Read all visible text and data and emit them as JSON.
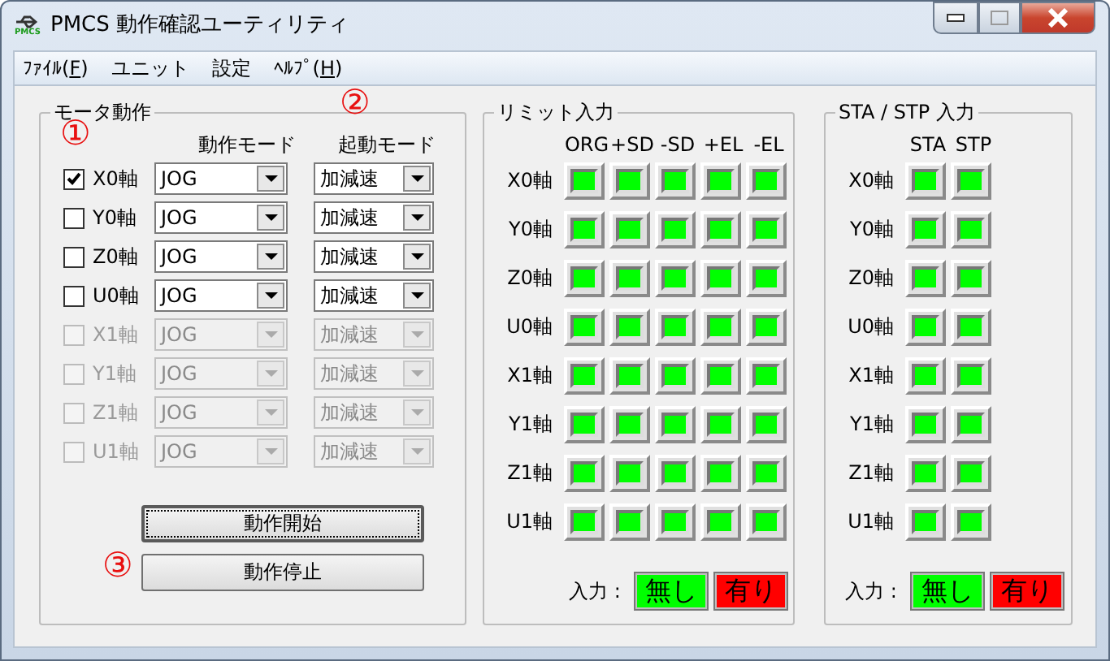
{
  "window": {
    "title": "PMCS 動作確認ユーティリティ",
    "icon_text": "PMCS"
  },
  "menu": [
    {
      "before": "ﾌｧｲﾙ(",
      "access_key": "F",
      "after": ")"
    },
    {
      "before": "ユニット"
    },
    {
      "before": "設定"
    },
    {
      "before": "ﾍﾙﾌﾟ(",
      "access_key": "H",
      "after": ")"
    }
  ],
  "motor": {
    "title": "モータ動作",
    "columns": [
      "動作モード",
      "起動モード"
    ],
    "axes": [
      {
        "label": "X0軸",
        "checked": true,
        "disabled": false,
        "mode": "JOG",
        "start_mode": "加減速"
      },
      {
        "label": "Y0軸",
        "checked": false,
        "disabled": false,
        "mode": "JOG",
        "start_mode": "加減速"
      },
      {
        "label": "Z0軸",
        "checked": false,
        "disabled": false,
        "mode": "JOG",
        "start_mode": "加減速"
      },
      {
        "label": "U0軸",
        "checked": false,
        "disabled": false,
        "mode": "JOG",
        "start_mode": "加減速"
      },
      {
        "label": "X1軸",
        "checked": false,
        "disabled": true,
        "mode": "JOG",
        "start_mode": "加減速"
      },
      {
        "label": "Y1軸",
        "checked": false,
        "disabled": true,
        "mode": "JOG",
        "start_mode": "加減速"
      },
      {
        "label": "Z1軸",
        "checked": false,
        "disabled": true,
        "mode": "JOG",
        "start_mode": "加減速"
      },
      {
        "label": "U1軸",
        "checked": false,
        "disabled": true,
        "mode": "JOG",
        "start_mode": "加減速"
      }
    ],
    "buttons": [
      {
        "label": "動作開始",
        "focused": true
      },
      {
        "label": "動作停止",
        "focused": false
      }
    ]
  },
  "annotations": [
    "①",
    "②",
    "③"
  ],
  "limit": {
    "title": "リミット入力",
    "columns": [
      "ORG",
      "+SD",
      "-SD",
      "+EL",
      "-EL"
    ],
    "rows": [
      {
        "label": "X0軸",
        "inputs": [
          {
            "on": false
          },
          {
            "on": false
          },
          {
            "on": false
          },
          {
            "on": false
          },
          {
            "on": false
          }
        ]
      },
      {
        "label": "Y0軸",
        "inputs": [
          {
            "on": false
          },
          {
            "on": false
          },
          {
            "on": false
          },
          {
            "on": false
          },
          {
            "on": false
          }
        ]
      },
      {
        "label": "Z0軸",
        "inputs": [
          {
            "on": false
          },
          {
            "on": false
          },
          {
            "on": false
          },
          {
            "on": false
          },
          {
            "on": false
          }
        ]
      },
      {
        "label": "U0軸",
        "inputs": [
          {
            "on": false
          },
          {
            "on": false
          },
          {
            "on": false
          },
          {
            "on": false
          },
          {
            "on": false
          }
        ]
      },
      {
        "label": "X1軸",
        "inputs": [
          {
            "on": false
          },
          {
            "on": false
          },
          {
            "on": false
          },
          {
            "on": false
          },
          {
            "on": false
          }
        ]
      },
      {
        "label": "Y1軸",
        "inputs": [
          {
            "on": false
          },
          {
            "on": false
          },
          {
            "on": false
          },
          {
            "on": false
          },
          {
            "on": false
          }
        ]
      },
      {
        "label": "Z1軸",
        "inputs": [
          {
            "on": false
          },
          {
            "on": false
          },
          {
            "on": false
          },
          {
            "on": false
          },
          {
            "on": false
          }
        ]
      },
      {
        "label": "U1軸",
        "inputs": [
          {
            "on": false
          },
          {
            "on": false
          },
          {
            "on": false
          },
          {
            "on": false
          },
          {
            "on": false
          }
        ]
      }
    ],
    "legend": {
      "label": "入力 :",
      "items": [
        {
          "text": "無し",
          "color": "#00ff00"
        },
        {
          "text": "有り",
          "color": "#ff0000"
        }
      ]
    }
  },
  "sta_stp": {
    "title": "STA / STP 入力",
    "columns": [
      "STA",
      "STP"
    ],
    "rows": [
      {
        "label": "X0軸",
        "inputs": [
          {
            "on": false
          },
          {
            "on": false
          }
        ]
      },
      {
        "label": "Y0軸",
        "inputs": [
          {
            "on": false
          },
          {
            "on": false
          }
        ]
      },
      {
        "label": "Z0軸",
        "inputs": [
          {
            "on": false
          },
          {
            "on": false
          }
        ]
      },
      {
        "label": "U0軸",
        "inputs": [
          {
            "on": false
          },
          {
            "on": false
          }
        ]
      },
      {
        "label": "X1軸",
        "inputs": [
          {
            "on": false
          },
          {
            "on": false
          }
        ]
      },
      {
        "label": "Y1軸",
        "inputs": [
          {
            "on": false
          },
          {
            "on": false
          }
        ]
      },
      {
        "label": "Z1軸",
        "inputs": [
          {
            "on": false
          },
          {
            "on": false
          }
        ]
      },
      {
        "label": "U1軸",
        "inputs": [
          {
            "on": false
          },
          {
            "on": false
          }
        ]
      }
    ],
    "legend": {
      "label": "入力 :",
      "items": [
        {
          "text": "無し",
          "color": "#00ff00"
        },
        {
          "text": "有り",
          "color": "#ff0000"
        }
      ]
    }
  }
}
